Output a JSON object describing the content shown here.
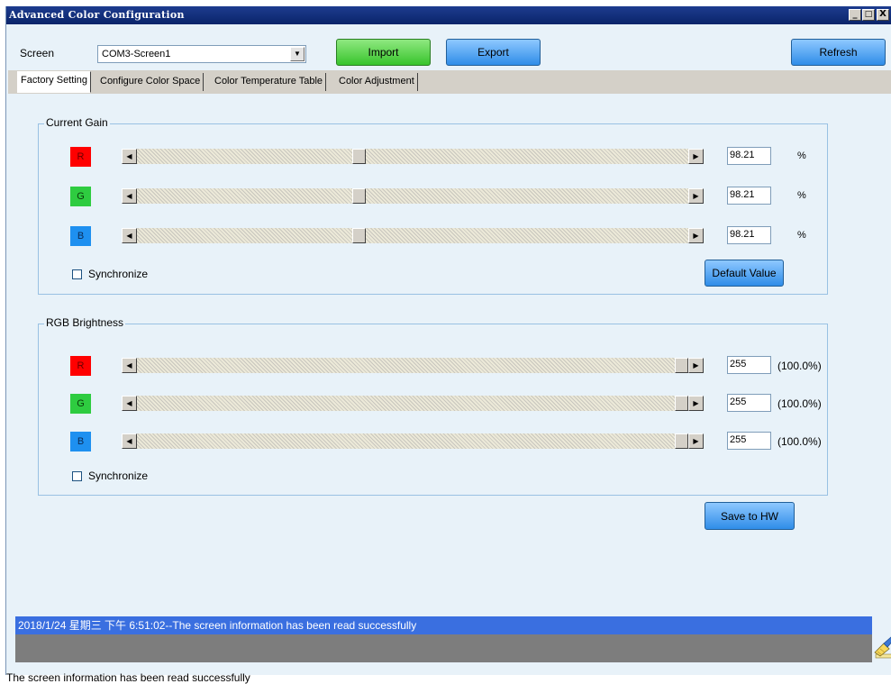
{
  "window": {
    "title": "Advanced Color Configuration",
    "minimize": "_",
    "maximize": "□",
    "close": "X"
  },
  "header": {
    "screen_label": "Screen",
    "screen_select_value": "COM3-Screen1",
    "import_label": "Import",
    "export_label": "Export",
    "refresh_label": "Refresh"
  },
  "tabs": [
    {
      "label": "Factory Setting",
      "active": true
    },
    {
      "label": "Configure Color Space",
      "active": false
    },
    {
      "label": "Color Temperature Table",
      "active": false
    },
    {
      "label": "Color Adjustment",
      "active": false
    }
  ],
  "current_gain": {
    "title": "Current Gain",
    "channels": [
      {
        "label": "R",
        "value": "98.21",
        "unit": "%",
        "level": 0.4
      },
      {
        "label": "G",
        "value": "98.21",
        "unit": "%",
        "level": 0.4
      },
      {
        "label": "B",
        "value": "98.21",
        "unit": "%",
        "level": 0.4
      }
    ],
    "synchronize_label": "Synchronize",
    "default_value_label": "Default Value"
  },
  "rgb_brightness": {
    "title": "RGB Brightness",
    "channels": [
      {
        "label": "R",
        "value": "255",
        "unit": "(100.0%)",
        "level": 1.0
      },
      {
        "label": "G",
        "value": "255",
        "unit": "(100.0%)",
        "level": 1.0
      },
      {
        "label": "B",
        "value": "255",
        "unit": "(100.0%)",
        "level": 1.0
      }
    ],
    "synchronize_label": "Synchronize"
  },
  "save_to_hw_label": "Save to HW",
  "status": {
    "log_line": "2018/1/24 星期三 下午 6:51:02--The screen information has been read successfully",
    "bottom_text": "The screen information has been read successfully"
  },
  "icons": {
    "clear_log": "broom-icon",
    "scroll_left": "arrow-left-icon",
    "scroll_right": "arrow-right-icon",
    "dropdown": "chevron-down-icon"
  }
}
